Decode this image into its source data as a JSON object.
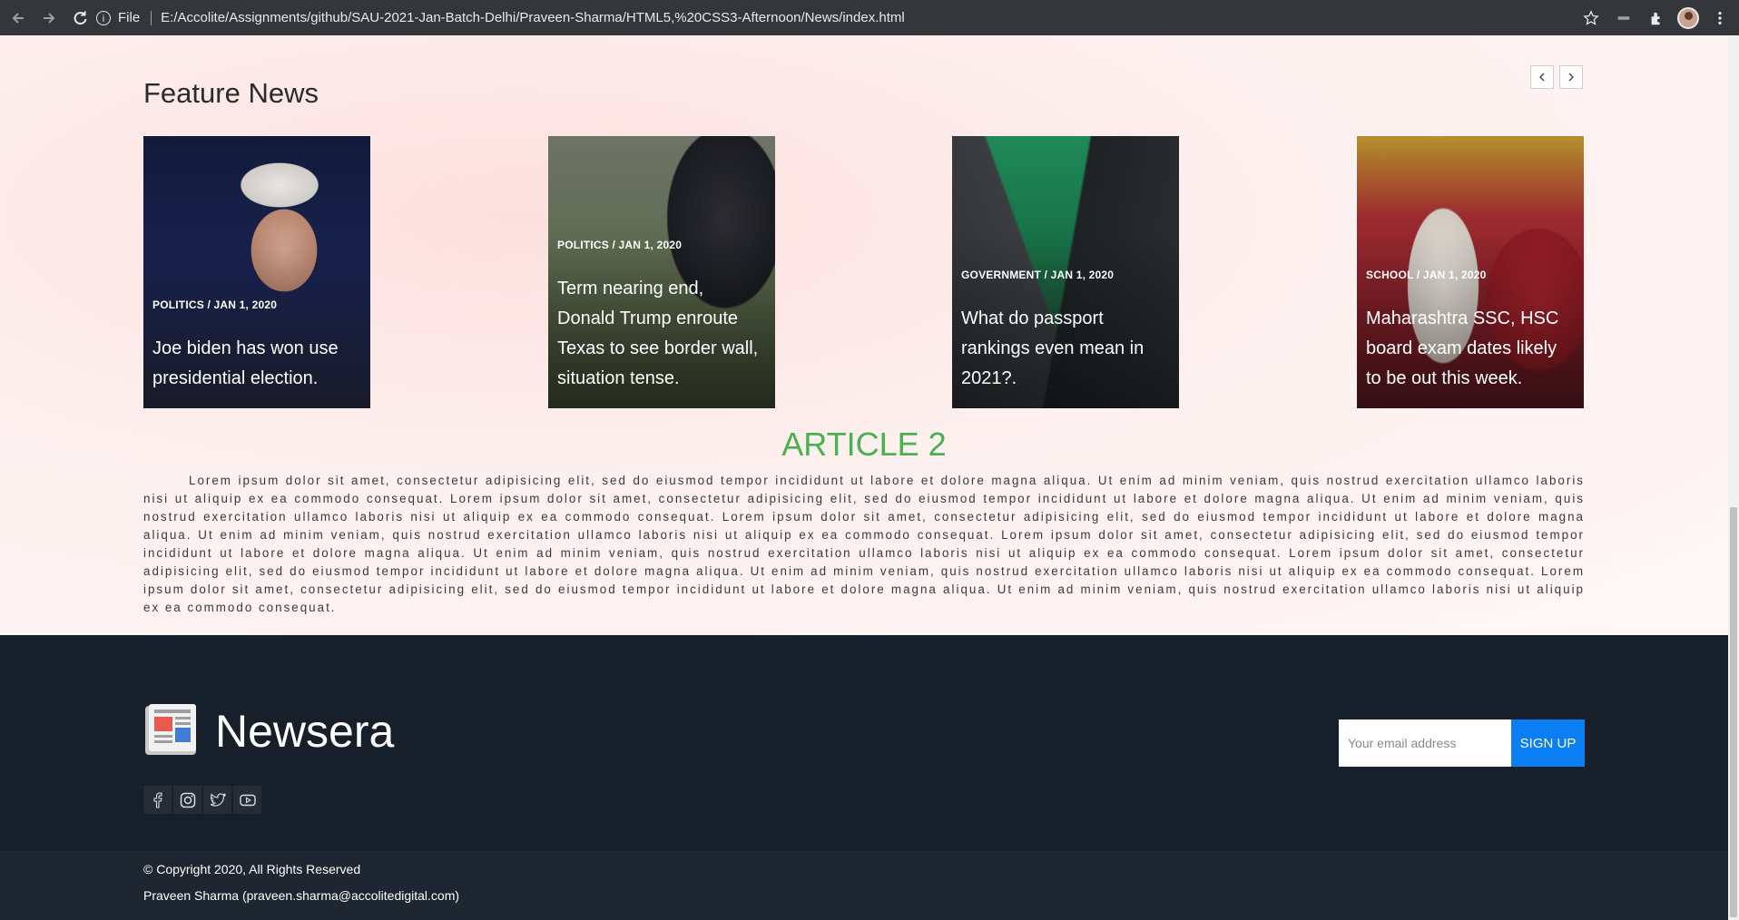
{
  "browser": {
    "protocol_label": "File",
    "url": "E:/Accolite/Assignments/github/SAU-2021-Jan-Batch-Delhi/Praveen-Sharma/HTML5,%20CSS3-Afternoon/News/index.html",
    "icons": [
      "back-arrow-icon",
      "forward-arrow-icon",
      "reload-icon",
      "info-icon",
      "star-icon",
      "extensions-icon",
      "profile-avatar",
      "menu-icon"
    ]
  },
  "feature": {
    "title": "Feature News",
    "cards": [
      {
        "meta": "POLITICS / JAN 1, 2020",
        "headline": "Joe biden has won use presidential election."
      },
      {
        "meta": "POLITICS / JAN 1, 2020",
        "headline": "Term nearing end, Donald Trump enroute Texas to see border wall, situation tense."
      },
      {
        "meta": "GOVERNMENT / JAN 1, 2020",
        "headline": "What do passport rankings even mean in 2021?."
      },
      {
        "meta": "SCHOOL / JAN 1, 2020",
        "headline": "Maharashtra SSC, HSC board exam dates likely to be out this week."
      }
    ]
  },
  "article": {
    "title": "ARTICLE 2",
    "body": "Lorem ipsum dolor sit amet, consectetur adipisicing elit, sed do eiusmod tempor incididunt ut labore et dolore magna aliqua. Ut enim ad minim veniam, quis nostrud exercitation ullamco laboris nisi ut aliquip ex ea commodo consequat. Lorem ipsum dolor sit amet, consectetur adipisicing elit, sed do eiusmod tempor incididunt ut labore et dolore magna aliqua. Ut enim ad minim veniam, quis nostrud exercitation ullamco laboris nisi ut aliquip ex ea commodo consequat. Lorem ipsum dolor sit amet, consectetur adipisicing elit, sed do eiusmod tempor incididunt ut labore et dolore magna aliqua. Ut enim ad minim veniam, quis nostrud exercitation ullamco laboris nisi ut aliquip ex ea commodo consequat. Lorem ipsum dolor sit amet, consectetur adipisicing elit, sed do eiusmod tempor incididunt ut labore et dolore magna aliqua. Ut enim ad minim veniam, quis nostrud exercitation ullamco laboris nisi ut aliquip ex ea commodo consequat. Lorem ipsum dolor sit amet, consectetur adipisicing elit, sed do eiusmod tempor incididunt ut labore et dolore magna aliqua. Ut enim ad minim veniam, quis nostrud exercitation ullamco laboris nisi ut aliquip ex ea commodo consequat. Lorem ipsum dolor sit amet, consectetur adipisicing elit, sed do eiusmod tempor incididunt ut labore et dolore magna aliqua. Ut enim ad minim veniam, quis nostrud exercitation ullamco laboris nisi ut aliquip ex ea commodo consequat."
  },
  "footer": {
    "brand": "Newsera",
    "email_placeholder": "Your email address",
    "signup_label": "SIGN UP",
    "socials": [
      "facebook-icon",
      "instagram-icon",
      "twitter-icon",
      "youtube-icon"
    ],
    "copyright": "© Copyright 2020, All Rights Reserved",
    "author": "Praveen Sharma (praveen.sharma@accolitedigital.com)"
  },
  "colors": {
    "article_title": "#4caf50",
    "footer_bg": "#17202a",
    "signup_bg": "#0a7ef2"
  }
}
